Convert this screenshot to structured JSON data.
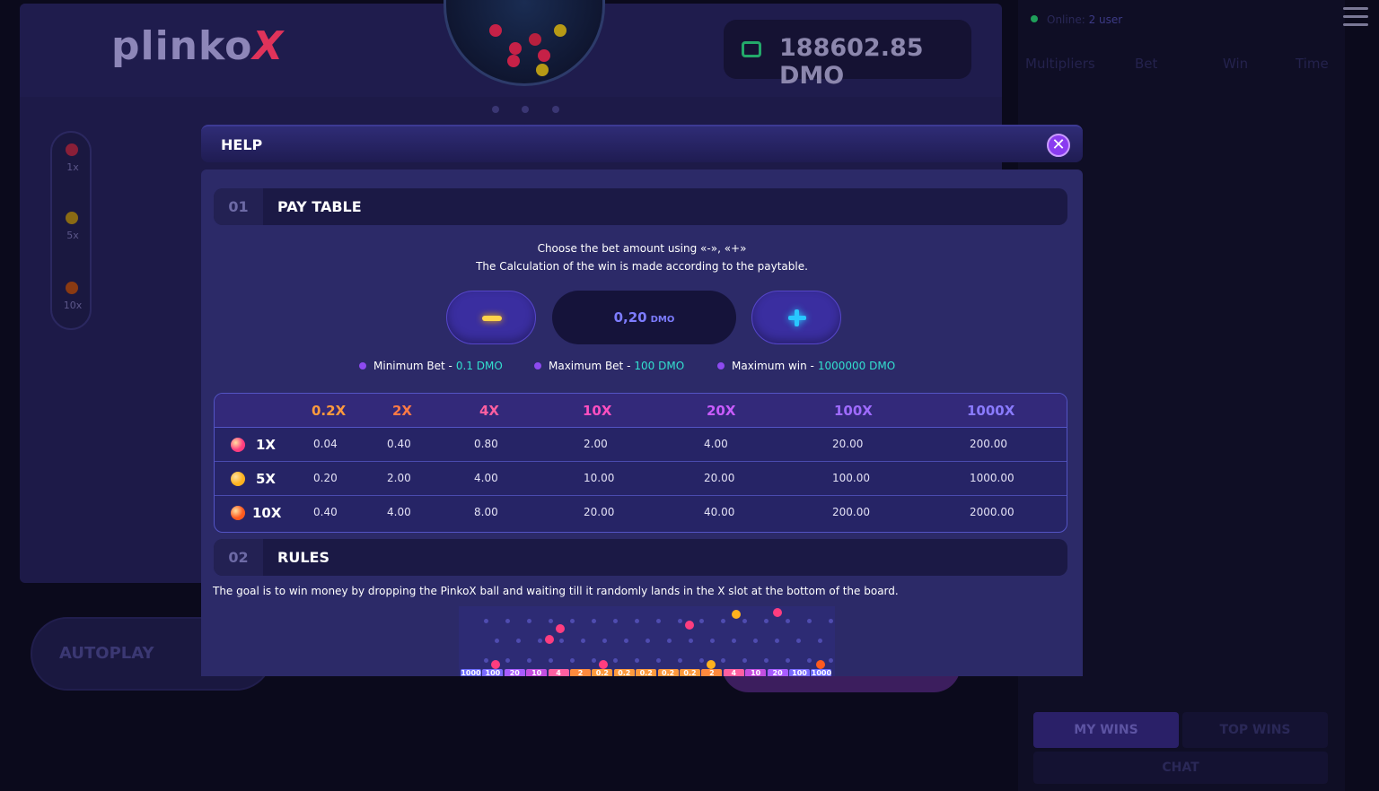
{
  "game": {
    "logo": "plinko",
    "logo_x": "X",
    "balance": "188602.85 DMO",
    "legend": [
      "1x",
      "5x",
      "10x"
    ],
    "autoplay_label": "AUTOPLAY"
  },
  "side": {
    "online_label": "Online:",
    "online_users": "2 user",
    "headers": [
      "Multipliers",
      "Bet",
      "Win",
      "Time"
    ],
    "tabs": {
      "my_wins": "MY WINS",
      "top_wins": "TOP WINS",
      "chat": "CHAT"
    }
  },
  "help": {
    "title": "HELP",
    "close_symbol": "✕",
    "section1": {
      "number": "01",
      "title": "PAY TABLE",
      "line1": "Choose the bet amount using «-», «+»",
      "line2": "The Calculation of the win is made according to the paytable.",
      "bet_value": "0,20",
      "bet_unit": "DMO",
      "limits": [
        {
          "label": "Minimum Bet -",
          "value": "0.1 DMO"
        },
        {
          "label": "Maximum Bet -",
          "value": "100 DMO"
        },
        {
          "label": "Maximum win -",
          "value": "1000000 DMO"
        }
      ]
    },
    "paytable": {
      "columns": [
        "0.2X",
        "2X",
        "4X",
        "10X",
        "20X",
        "100X",
        "1000X"
      ],
      "column_colors": [
        "#ff9a3d",
        "#ff7a45",
        "#ff5fa0",
        "#ff4fc0",
        "#c95cff",
        "#9f6bff",
        "#8a7bff"
      ],
      "rows": [
        {
          "label": "1X",
          "ball_color": "#ff3d7f",
          "values": [
            "0.04",
            "0.40",
            "0.80",
            "2.00",
            "4.00",
            "20.00",
            "200.00"
          ]
        },
        {
          "label": "5X",
          "ball_color": "#ffb21e",
          "values": [
            "0.20",
            "2.00",
            "4.00",
            "10.00",
            "20.00",
            "100.00",
            "1000.00"
          ]
        },
        {
          "label": "10X",
          "ball_color": "#ff5a1f",
          "values": [
            "0.40",
            "4.00",
            "8.00",
            "20.00",
            "40.00",
            "200.00",
            "2000.00"
          ]
        }
      ]
    },
    "section2": {
      "number": "02",
      "title": "RULES",
      "text": "The goal is to win money by dropping the PinkoX ball and waiting till it randomly lands in the X slot at the bottom of the board."
    },
    "board_slots": [
      "1000",
      "100",
      "20",
      "10",
      "4",
      "2",
      "0.2",
      "0.2",
      "0.2",
      "0.2",
      "0.2",
      "2",
      "4",
      "10",
      "20",
      "100",
      "1000"
    ]
  }
}
